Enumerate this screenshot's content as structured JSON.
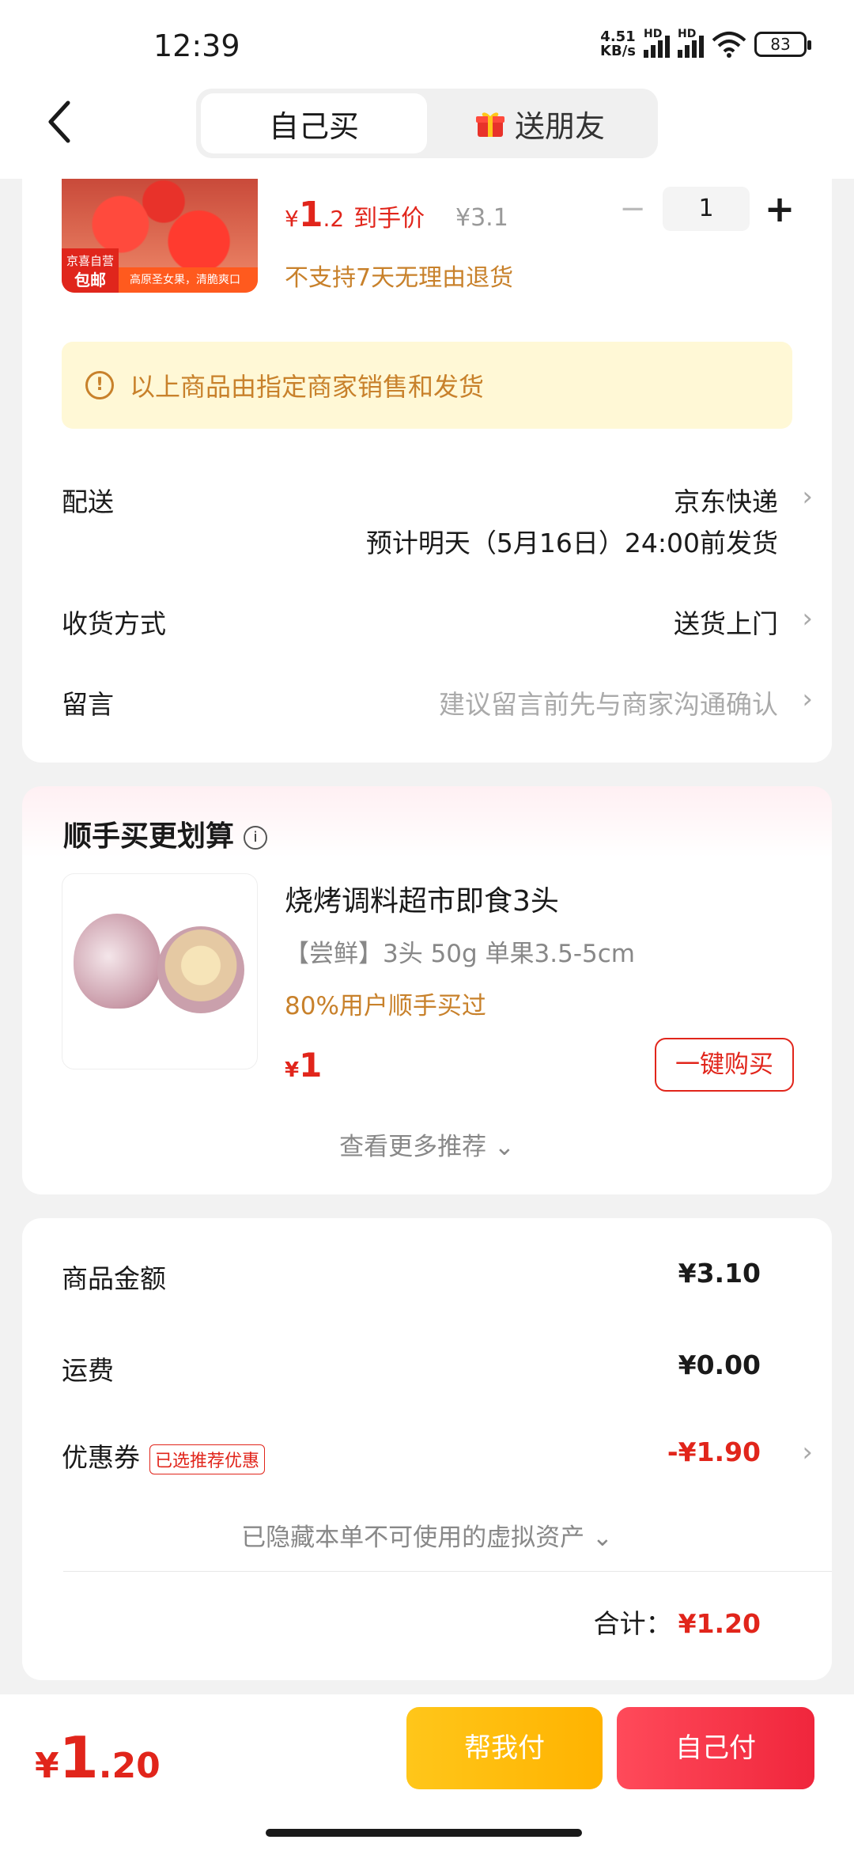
{
  "status": {
    "time": "12:39",
    "net_speed_top": "4.51",
    "net_speed_bottom": "KB/s",
    "hd1": "HD",
    "hd2": "HD",
    "battery": "83"
  },
  "header": {
    "tab_self": "自己买",
    "tab_friend": "送朋友"
  },
  "product": {
    "currency": "¥",
    "price_int": "1",
    "price_dec": ".2",
    "price_label": "到手价",
    "original_price": "¥3.1",
    "quantity": "1",
    "minus": "−",
    "plus": "+",
    "no_return": "不支持7天无理由退货",
    "badge_top": "京喜自营",
    "badge_bottom": "包邮",
    "banner": "高原圣女果，清脆爽口"
  },
  "notice": {
    "icon_text": "!",
    "text": "以上商品由指定商家销售和发货"
  },
  "delivery": {
    "label": "配送",
    "value": "京东快递",
    "sub": "预计明天（5月16日）24:00前发货"
  },
  "receive": {
    "label": "收货方式",
    "value": "送货上门"
  },
  "message": {
    "label": "留言",
    "placeholder": "建议留言前先与商家沟通确认"
  },
  "recommend": {
    "title": "顺手买更划算",
    "name": "烧烤调料超市即食3头",
    "spec": "【尝鲜】3头 50g 单果3.5-5cm",
    "bought": "80%用户顺手买过",
    "currency": "¥",
    "price": "1",
    "buy_button": "一键购买",
    "more": "查看更多推荐 ⌄"
  },
  "summary": {
    "goods_label": "商品金额",
    "goods_value": "¥3.10",
    "shipping_label": "运费",
    "shipping_value": "¥0.00",
    "coupon_label": "优惠券",
    "coupon_tag": "已选推荐优惠",
    "coupon_value": "-¥1.90",
    "hidden_note": "已隐藏本单不可使用的虚拟资产 ⌄",
    "total_label": "合计：",
    "total_value": "¥1.20"
  },
  "bottom": {
    "currency": "¥",
    "price_int": "1",
    "price_dec": ".20",
    "help_pay": "帮我付",
    "self_pay": "自己付"
  },
  "colors": {
    "accent": "#e1251b",
    "warning": "#c8812b",
    "yellow": "#ffc61a"
  }
}
